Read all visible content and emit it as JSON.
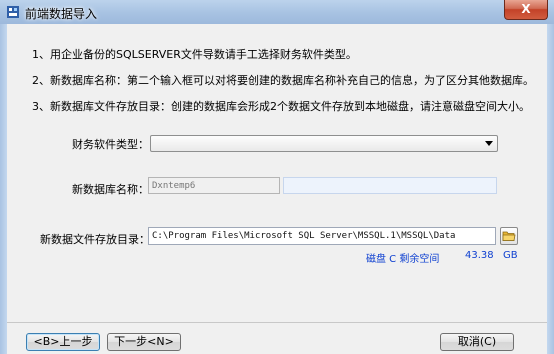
{
  "window": {
    "title": "前端数据导入",
    "close_label": "X"
  },
  "instructions": [
    "1、用企业备份的SQLSERVER文件导数请手工选择财务软件类型。",
    "2、新数据库名称：第二个输入框可以对将要创建的数据库名称补充自己的信息，为了区分其他数据库。",
    "3、新数据库文件存放目录：创建的数据库会形成2个数据文件存放到本地磁盘，请注意磁盘空间大小。"
  ],
  "form": {
    "software_type_label": "财务软件类型：",
    "software_type_value": "",
    "db_name_label": "新数据库名称：",
    "db_name_prefix": "Dxntemp6",
    "db_name_suffix": "",
    "path_label": "新数据文件存放目录：",
    "path_value": "C:\\Program Files\\Microsoft SQL Server\\MSSQL.1\\MSSQL\\Data",
    "disk_info_prefix": "磁盘 C 剩余空间",
    "disk_free": "43.38",
    "disk_unit": "GB"
  },
  "buttons": {
    "prev": "<B>上一步",
    "next": "下一步<N>",
    "cancel": "取消(C)"
  },
  "colors": {
    "accent_link": "#0d3fd0",
    "close_button": "#c34228"
  }
}
